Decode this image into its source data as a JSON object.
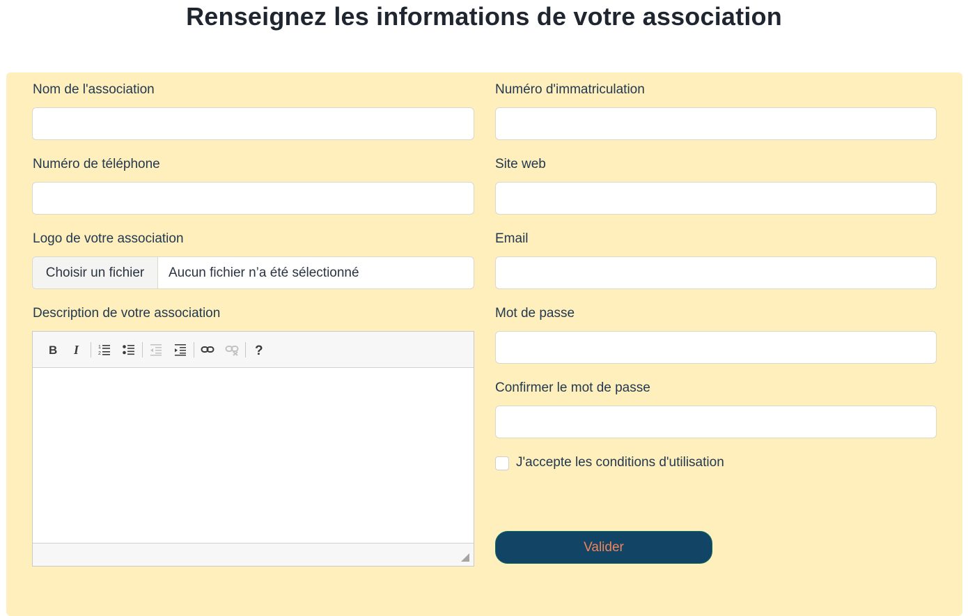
{
  "page": {
    "title": "Renseignez les informations de votre association"
  },
  "form": {
    "association_name": {
      "label": "Nom de l'association",
      "value": "",
      "placeholder": ""
    },
    "registration_number": {
      "label": "Numéro d'immatriculation",
      "value": "",
      "placeholder": ""
    },
    "phone": {
      "label": "Numéro de téléphone",
      "value": "",
      "placeholder": ""
    },
    "website": {
      "label": "Site web",
      "value": "",
      "placeholder": ""
    },
    "logo": {
      "label": "Logo de votre association",
      "button": "Choisir un fichier",
      "status": "Aucun fichier n’a été sélectionné"
    },
    "email": {
      "label": "Email",
      "value": "",
      "placeholder": ""
    },
    "description": {
      "label": "Description de votre association",
      "toolbar": [
        "bold-icon",
        "italic-icon",
        "numbered-list-icon",
        "bulleted-list-icon",
        "outdent-icon",
        "indent-icon",
        "link-icon",
        "unlink-icon",
        "help-icon"
      ]
    },
    "password": {
      "label": "Mot de passe",
      "value": "",
      "placeholder": ""
    },
    "password_confirm": {
      "label": "Confirmer le mot de passe",
      "value": "",
      "placeholder": ""
    },
    "terms": {
      "label": "J'accepte les conditions d'utilisation",
      "checked": false
    },
    "submit_label": "Valider"
  },
  "colors": {
    "panel_bg": "#ffefbd",
    "button_bg": "#124466",
    "button_text": "#f0845a",
    "label_text": "#22394f"
  }
}
